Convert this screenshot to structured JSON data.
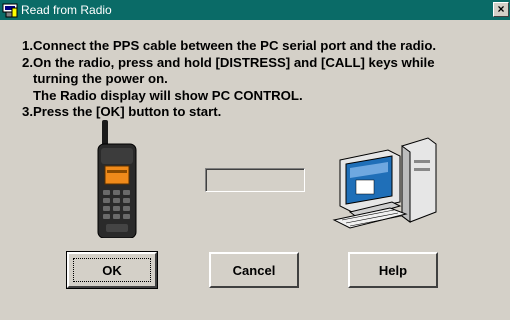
{
  "window": {
    "title": "Read from Radio",
    "close_glyph": "×"
  },
  "instructions": {
    "line1": "1.Connect the PPS cable between the PC serial port and the radio.",
    "line2": "2.On the radio, press and hold [DISTRESS] and [CALL] keys while",
    "line3": "   turning the power on.",
    "line4": "   The Radio display will show PC CONTROL.",
    "line5": "3.Press the [OK] button to start."
  },
  "progress": {
    "value": 0
  },
  "buttons": {
    "ok": "OK",
    "cancel": "Cancel",
    "help": "Help"
  },
  "icons": {
    "app": "radio-app-icon",
    "radio": "handheld-radio-icon",
    "computer": "desktop-computer-icon"
  },
  "colors": {
    "titlebar": "#0a6b67",
    "dialog": "#d4d0c8",
    "radio_display": "#f08a1a",
    "monitor_screen": "#1f6fb8"
  }
}
